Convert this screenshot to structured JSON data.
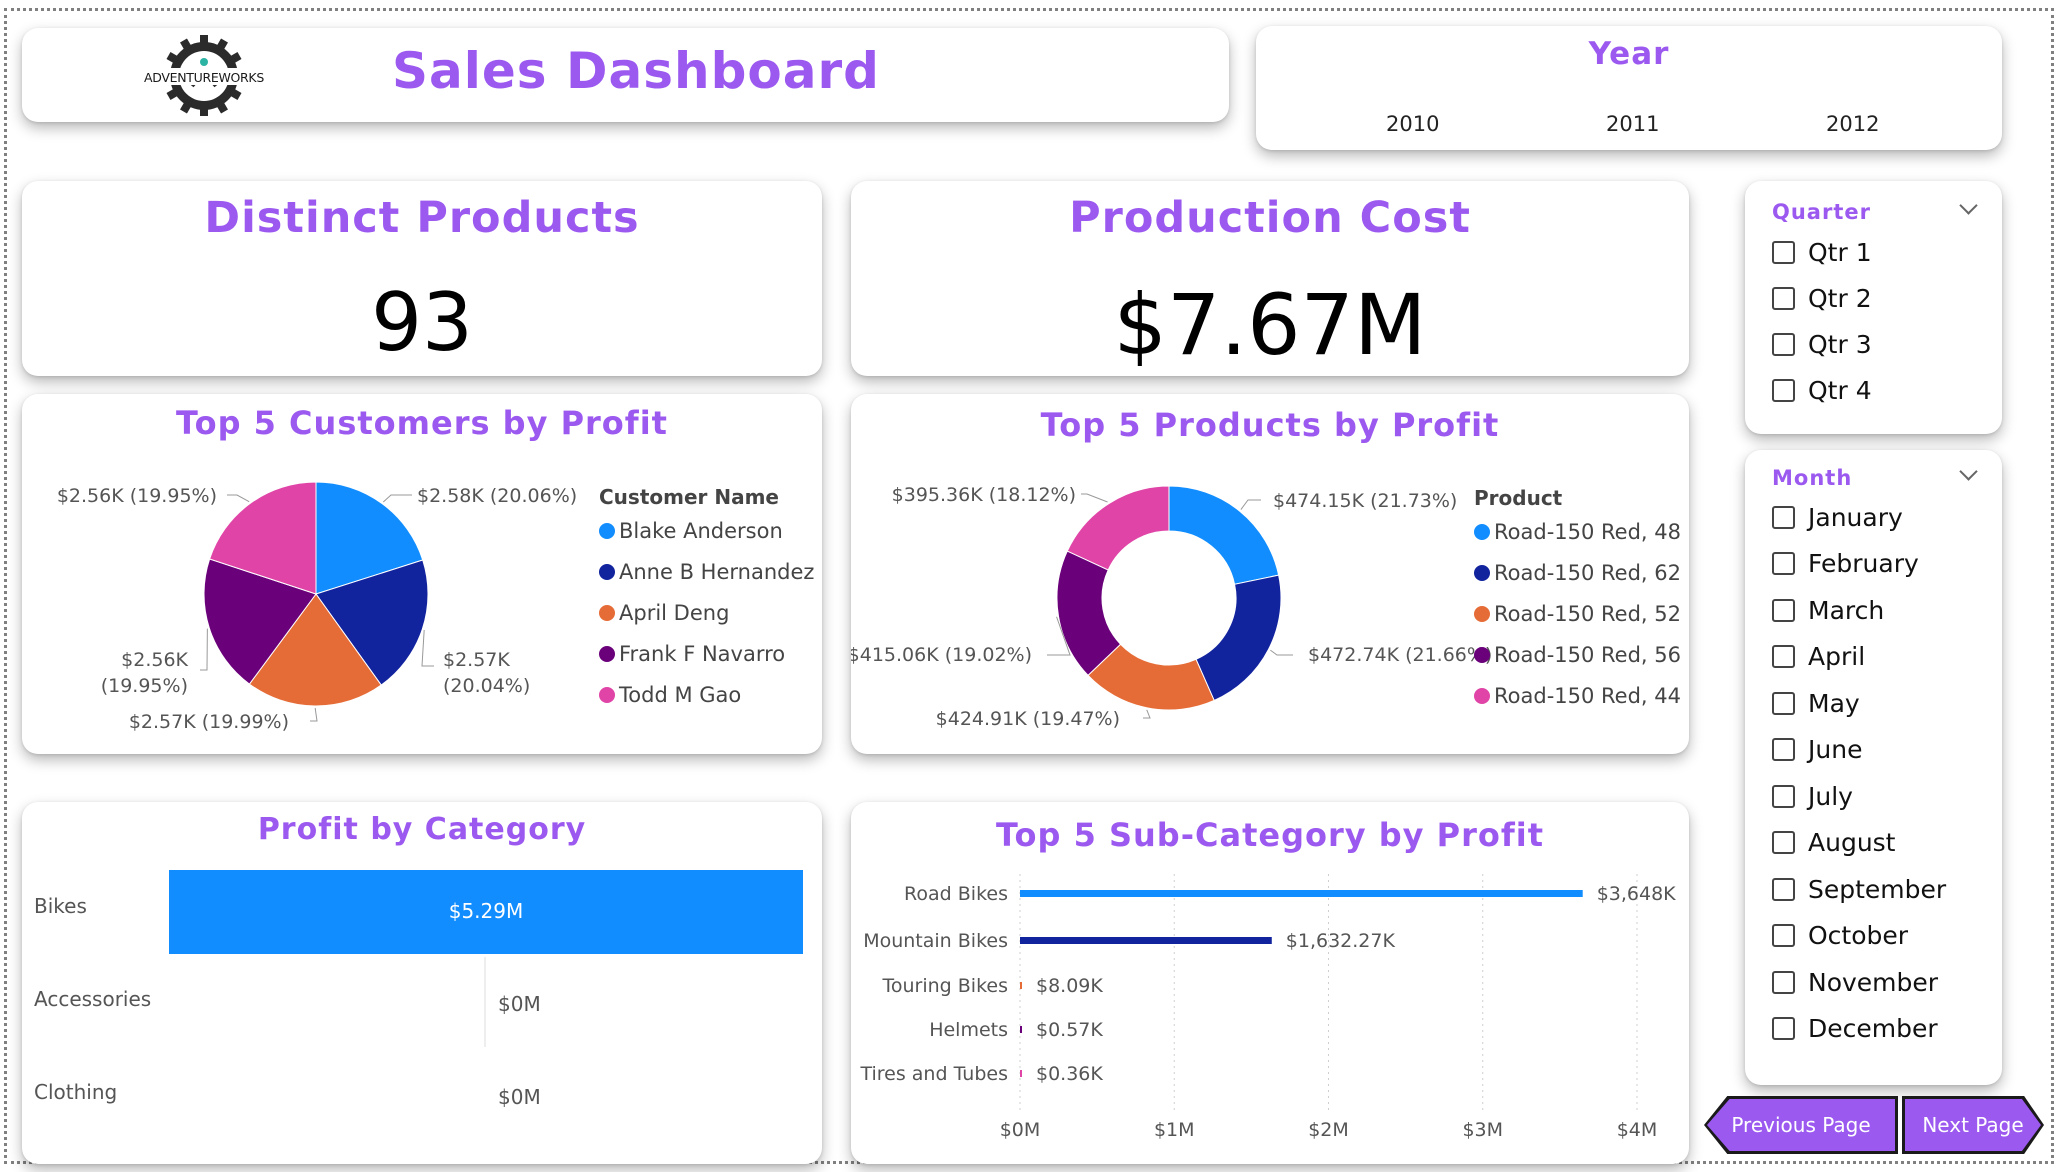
{
  "header": {
    "logo_text": "ADVENTUREWORKS",
    "title": "Sales Dashboard"
  },
  "year_slicer": {
    "title": "Year",
    "items": [
      "2010",
      "2011",
      "2012"
    ]
  },
  "kpis": {
    "distinct_products": {
      "label": "Distinct Products",
      "value": "93"
    },
    "production_cost": {
      "label": "Production Cost",
      "value": "$7.67M"
    }
  },
  "quarter_slicer": {
    "title": "Quarter",
    "items": [
      "Qtr 1",
      "Qtr 2",
      "Qtr 3",
      "Qtr 4"
    ]
  },
  "month_slicer": {
    "title": "Month",
    "items": [
      "January",
      "February",
      "March",
      "April",
      "May",
      "June",
      "July",
      "August",
      "September",
      "October",
      "November",
      "December"
    ]
  },
  "navigation": {
    "previous": "Previous Page",
    "next": "Next Page"
  },
  "colors": {
    "accent": "#9b59f0",
    "series": [
      "#118dff",
      "#12239e",
      "#e66c37",
      "#6b007b",
      "#e044a7"
    ]
  },
  "chart_data": [
    {
      "type": "pie",
      "title": "Top 5 Customers by Profit",
      "legend_title": "Customer Name",
      "legend_position": "right",
      "categories": [
        "Blake Anderson",
        "Anne B Hernandez",
        "April Deng",
        "Frank F Navarro",
        "Todd M Gao"
      ],
      "values": [
        2.58,
        2.57,
        2.57,
        2.56,
        2.56
      ],
      "unit": "$K",
      "data_labels": [
        "$2.58K (20.06%)",
        "$2.57K (20.04%)",
        "$2.57K (19.99%)",
        "$2.56K (19.95%)",
        "$2.56K (19.95%)"
      ]
    },
    {
      "type": "pie",
      "donut": true,
      "title": "Top 5 Products by Profit",
      "legend_title": "Product",
      "legend_position": "right",
      "categories": [
        "Road-150 Red, 48",
        "Road-150 Red, 62",
        "Road-150 Red, 52",
        "Road-150 Red, 56",
        "Road-150 Red, 44"
      ],
      "values": [
        474.15,
        472.74,
        424.91,
        415.06,
        395.36
      ],
      "unit": "$K",
      "data_labels": [
        "$474.15K (21.73%)",
        "$472.74K (21.66%)",
        "$424.91K (19.47%)",
        "$415.06K (19.02%)",
        "$395.36K (18.12%)"
      ]
    },
    {
      "type": "bar",
      "orientation": "horizontal",
      "title": "Profit by Category",
      "categories": [
        "Bikes",
        "Accessories",
        "Clothing"
      ],
      "values": [
        5.29,
        0,
        0
      ],
      "unit": "$M",
      "data_labels": [
        "$5.29M",
        "$0M",
        "$0M"
      ]
    },
    {
      "type": "bar",
      "orientation": "horizontal",
      "title": "Top 5 Sub-Category by Profit",
      "categories": [
        "Road Bikes",
        "Mountain Bikes",
        "Touring Bikes",
        "Helmets",
        "Tires and Tubes"
      ],
      "values": [
        3648,
        1632.27,
        8.09,
        0.57,
        0.36
      ],
      "unit": "$K",
      "data_labels": [
        "$3,648K",
        "$1,632.27K",
        "$8.09K",
        "$0.57K",
        "$0.36K"
      ],
      "xticks": [
        "$0M",
        "$1M",
        "$2M",
        "$3M",
        "$4M"
      ],
      "xlim": [
        0,
        4000
      ],
      "grid": true
    }
  ]
}
